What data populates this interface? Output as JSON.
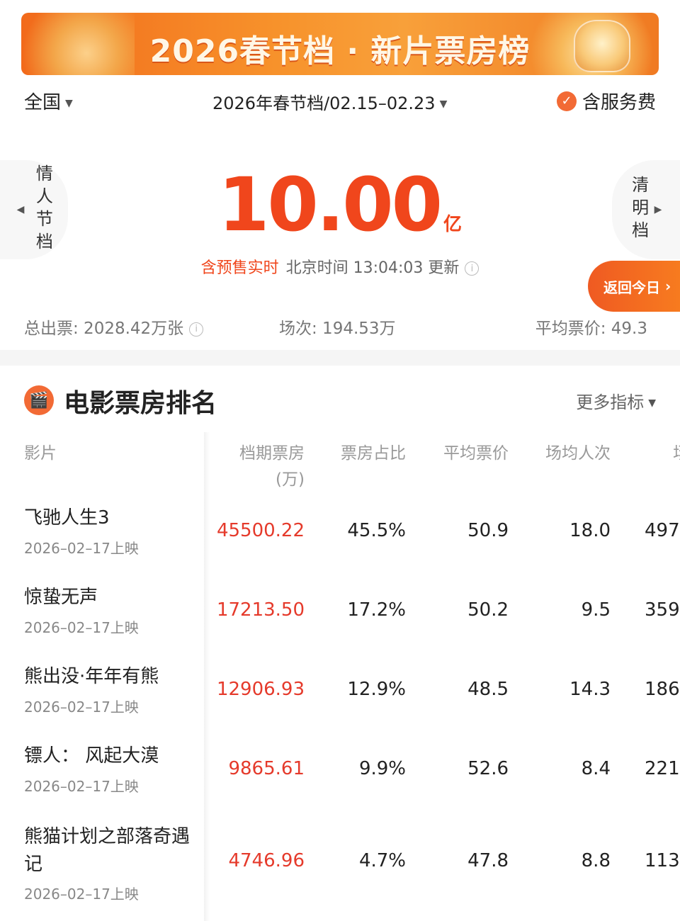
{
  "banner": {
    "title": "2026春节档 · 新片票房榜"
  },
  "filters": {
    "region": "全国",
    "period": "2026年春节档/02.15–02.23",
    "service_fee": "含服务费"
  },
  "side_tabs": {
    "prev": "情人节档",
    "next": "清明档"
  },
  "summary": {
    "total_value": "10.00",
    "total_unit": "亿",
    "live_label": "含预售实时",
    "update_text": "北京时间 13:04:03 更新",
    "today_button": "返回今日",
    "tickets": "总出票: 2028.42万张",
    "shows": "场次: 194.53万",
    "avg_price": "平均票价: 49.3"
  },
  "section": {
    "title": "电影票房排名",
    "more": "更多指标"
  },
  "table": {
    "headers": {
      "film": "影片",
      "gross": "档期票房",
      "gross_unit": "(万)",
      "share": "票房占比",
      "avg_price": "平均票价",
      "per_show": "场均人次",
      "next": "场"
    },
    "rows": [
      {
        "name": "飞驰人生3",
        "date": "2026–02–17上映",
        "gross": "45500.22",
        "share": "45.5%",
        "avg_price": "50.9",
        "per_show": "18.0",
        "next": "497"
      },
      {
        "name": "惊蛰无声",
        "date": "2026–02–17上映",
        "gross": "17213.50",
        "share": "17.2%",
        "avg_price": "50.2",
        "per_show": "9.5",
        "next": "359"
      },
      {
        "name": "熊出没·年年有熊",
        "date": "2026–02–17上映",
        "gross": "12906.93",
        "share": "12.9%",
        "avg_price": "48.5",
        "per_show": "14.3",
        "next": "186"
      },
      {
        "name": "镖人： 风起大漠",
        "date": "2026–02–17上映",
        "gross": "9865.61",
        "share": "9.9%",
        "avg_price": "52.6",
        "per_show": "8.4",
        "next": "221"
      },
      {
        "name": "熊猫计划之部落奇遇记",
        "date": "2026–02–17上映",
        "gross": "4746.96",
        "share": "4.7%",
        "avg_price": "47.8",
        "per_show": "8.8",
        "next": "113"
      }
    ]
  },
  "colors": {
    "accent": "#f0461c",
    "gross_red": "#e53a2b",
    "banner": "#f7922b"
  }
}
